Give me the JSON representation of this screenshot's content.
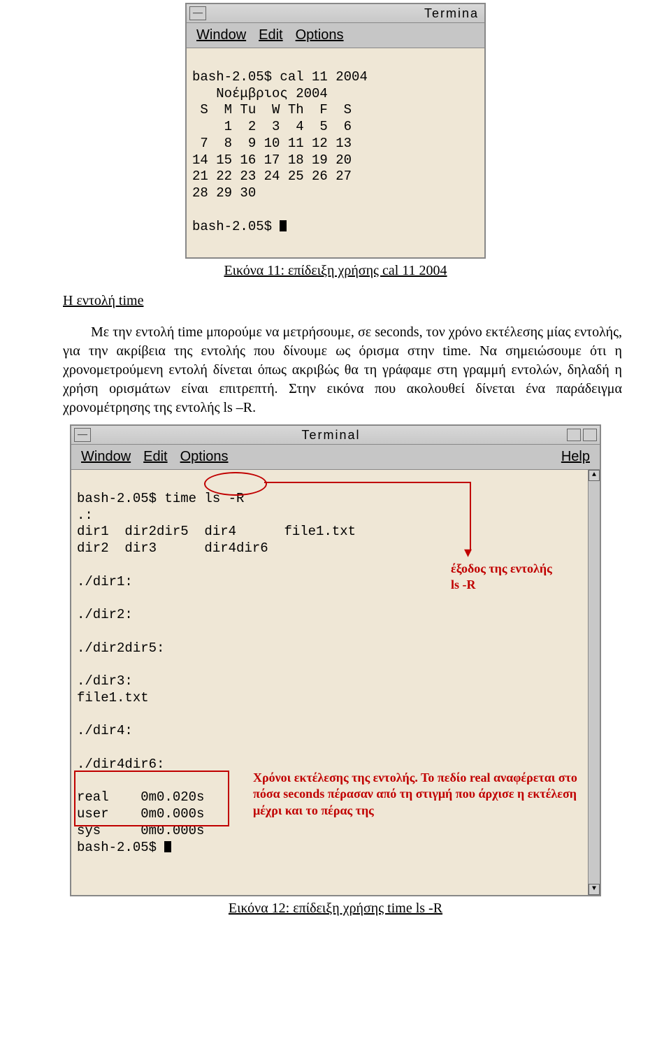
{
  "terminal1": {
    "title": "Termina",
    "menu": {
      "window": "Window",
      "edit": "Edit",
      "options": "Options"
    },
    "lines": [
      "bash-2.05$ cal 11 2004",
      "   Νοέμβριος 2004",
      " S  M Tu  W Th  F  S",
      "    1  2  3  4  5  6",
      " 7  8  9 10 11 12 13",
      "14 15 16 17 18 19 20",
      "21 22 23 24 25 26 27",
      "28 29 30",
      "",
      "bash-2.05$ "
    ]
  },
  "caption1": "Εικόνα 11: επίδειξη χρήσης cal 11 2004",
  "heading": "Η εντολή time",
  "paragraph": "Με την εντολή time μπορούμε να μετρήσουμε, σε seconds, τον χρόνο εκτέλεσης μίας εντολής, για την ακρίβεια της εντολής που δίνουμε ως όρισμα στην time. Να σημειώσουμε ότι η χρονομετρούμενη εντολή δίνεται όπως ακριβώς θα τη γράφαμε στη γραμμή εντολών, δηλαδή η χρήση ορισμάτων είναι επιτρεπτή. Στην εικόνα που ακολουθεί δίνεται ένα παράδειγμα χρονομέτρησης της εντολής ls –R.",
  "terminal2": {
    "title": "Terminal",
    "menu": {
      "window": "Window",
      "edit": "Edit",
      "options": "Options",
      "help": "Help"
    },
    "lines_top": [
      "bash-2.05$ time ls -R",
      ".:",
      "dir1  dir2dir5  dir4      file1.txt",
      "dir2  dir3      dir4dir6",
      "",
      "./dir1:",
      "",
      "./dir2:",
      "",
      "./dir2dir5:",
      "",
      "./dir3:",
      "file1.txt",
      "",
      "./dir4:",
      "",
      "./dir4dir6:",
      ""
    ],
    "time_output": [
      "real    0m0.020s",
      "user    0m0.000s",
      "sys     0m0.000s"
    ],
    "prompt_after": "bash-2.05$ "
  },
  "annotations": {
    "output_label_l1": "έξοδος της εντολής",
    "output_label_l2": "ls -R",
    "time_label": "Χρόνοι εκτέλεσης της εντολής. Το πεδίο real αναφέρεται στο πόσα seconds πέρασαν από τη στιγμή  που άρχισε η εκτέλεση μέχρι και το πέρας της"
  },
  "caption2": "Εικόνα 12: επίδειξη χρήσης time ls -R"
}
